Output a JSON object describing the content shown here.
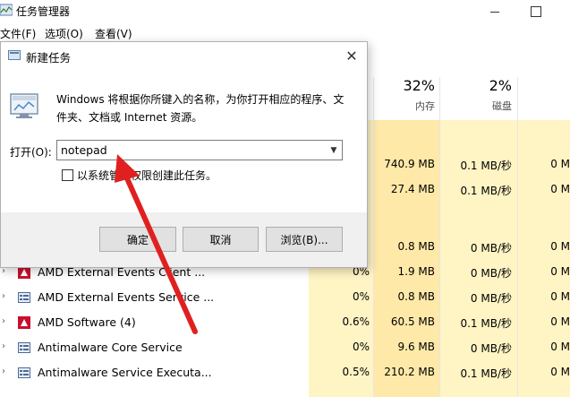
{
  "task_manager": {
    "title": "任务管理器",
    "menu": [
      "文件(F)",
      "选项(O)",
      "查看(V)"
    ],
    "headers": {
      "memory": {
        "percent": "32%",
        "label": "内存"
      },
      "disk": {
        "percent": "2%",
        "label": "磁盘"
      }
    },
    "rows": [
      {
        "name": "",
        "cpu": "",
        "memory": "740.9 MB",
        "disk": "0.1 MB/秒",
        "network": "0 M"
      },
      {
        "name": "",
        "cpu": "",
        "memory": "27.4 MB",
        "disk": "0.1 MB/秒",
        "network": "0 M"
      },
      {
        "name": "",
        "cpu": "",
        "memory": "",
        "disk": "",
        "network": ""
      },
      {
        "name": "",
        "cpu": "",
        "memory": "0.8 MB",
        "disk": "0 MB/秒",
        "network": "0 M"
      },
      {
        "name": "AMD External Events Client ...",
        "cpu": "0%",
        "memory": "1.9 MB",
        "disk": "0 MB/秒",
        "network": "0 M"
      },
      {
        "name": "AMD External Events Service ...",
        "cpu": "0%",
        "memory": "0.8 MB",
        "disk": "0 MB/秒",
        "network": "0 M"
      },
      {
        "name": "AMD Software (4)",
        "cpu": "0.6%",
        "memory": "60.5 MB",
        "disk": "0.1 MB/秒",
        "network": "0 M"
      },
      {
        "name": "Antimalware Core Service",
        "cpu": "0%",
        "memory": "9.6 MB",
        "disk": "0 MB/秒",
        "network": "0 M"
      },
      {
        "name": "Antimalware Service Executa...",
        "cpu": "0.5%",
        "memory": "210.2 MB",
        "disk": "0.1 MB/秒",
        "network": "0 M"
      }
    ],
    "row_icons": [
      "amd-icon",
      "service-icon",
      "amd-icon",
      "service-icon",
      "service-icon"
    ]
  },
  "run_dialog": {
    "title": "新建任务",
    "description": "Windows 将根据你所键入的名称，为你打开相应的程序、文件夹、文档或 Internet 资源。",
    "open_label": "打开(O):",
    "command_value": "notepad",
    "admin_checkbox_label": "以系统管理权限创建此任务。",
    "admin_checked": false,
    "ok_label": "确定",
    "cancel_label": "取消",
    "browse_label": "浏览(B)..."
  },
  "colors": {
    "cpu_column": "#fff4c4",
    "memory_column": "#ffe9a8",
    "annotation_arrow": "#e02020"
  }
}
